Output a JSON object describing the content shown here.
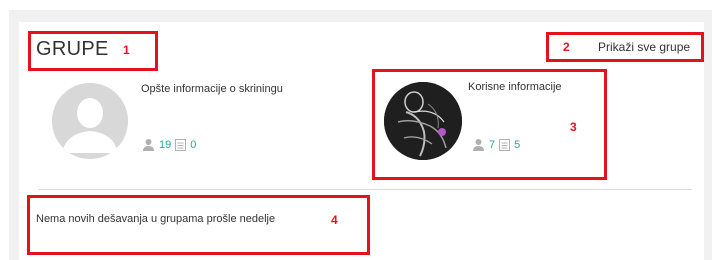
{
  "section": {
    "title": "GRUPE",
    "show_all_label": "Prikaži sve grupe",
    "no_activity_text": "Nema novih dešavanja u grupama prošle nedelje"
  },
  "groups": [
    {
      "name": "Opšte informacije o skriningu",
      "members": "19",
      "posts": "0",
      "avatar": "default-user-icon"
    },
    {
      "name": "Korisne informacije",
      "members": "7",
      "posts": "5",
      "avatar": "anatomy-photo"
    }
  ],
  "annotations": [
    "1",
    "2",
    "3",
    "4"
  ],
  "colors": {
    "accent_teal": "#2aa6a0",
    "annotation_red": "#e3121b",
    "icon_gray": "#b0b0b0"
  }
}
